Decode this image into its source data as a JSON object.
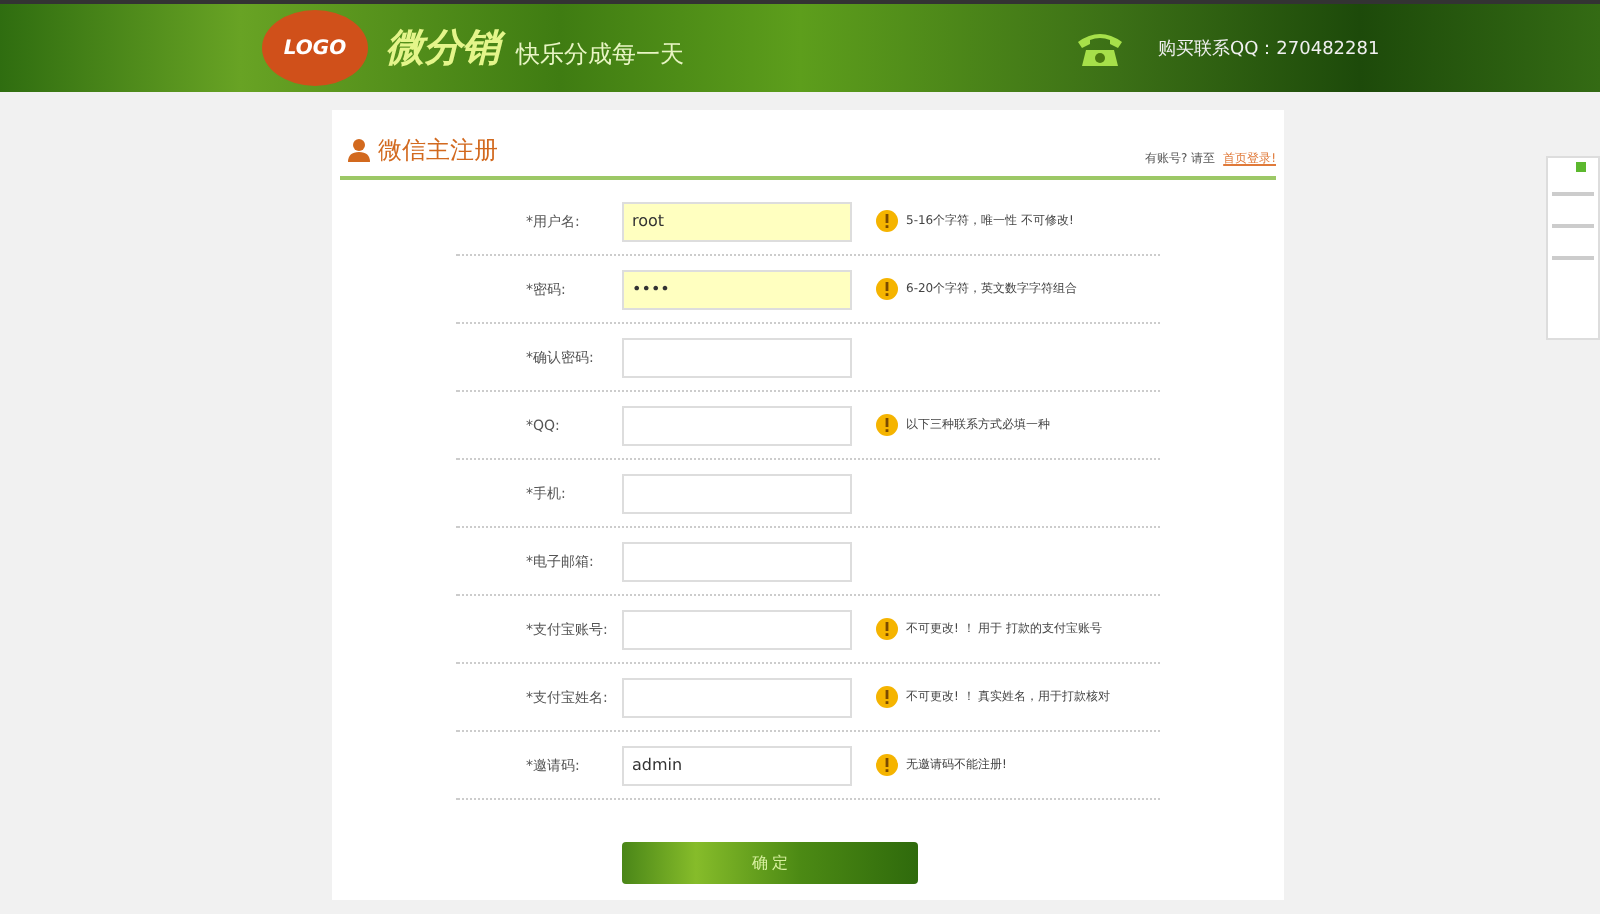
{
  "header": {
    "logo": "LOGO",
    "brand": "微分销",
    "slogan": "快乐分成每一天",
    "contact": "购买联系QQ：270482281"
  },
  "form": {
    "title": "微信主注册",
    "login_prompt": "有账号? 请至",
    "login_link": "首页登录!",
    "fields": [
      {
        "label": "*用户名:",
        "value": "root",
        "highlighted": true,
        "hint": "5-16个字符，唯一性 不可修改!"
      },
      {
        "label": "*密码:",
        "value": "••••",
        "highlighted": true,
        "hint": "6-20个字符，英文数字字符组合"
      },
      {
        "label": "*确认密码:",
        "highlighted": false
      },
      {
        "label": "*QQ:",
        "highlighted": false,
        "hint": "以下三种联系方式必填一种"
      },
      {
        "label": "*手机:",
        "highlighted": false
      },
      {
        "label": "*电子邮箱:",
        "highlighted": false
      },
      {
        "label": "*支付宝账号:",
        "highlighted": false,
        "hint": "不可更改! ！ 用于 打款的支付宝账号"
      },
      {
        "label": "*支付宝姓名:",
        "highlighted": false,
        "hint": "不可更改! ！ 真实姓名，用于打款核对"
      },
      {
        "label": "*邀请码:",
        "value": "admin",
        "highlighted": false,
        "hint": "无邀请码不能注册!"
      }
    ],
    "submit": "确 定"
  }
}
